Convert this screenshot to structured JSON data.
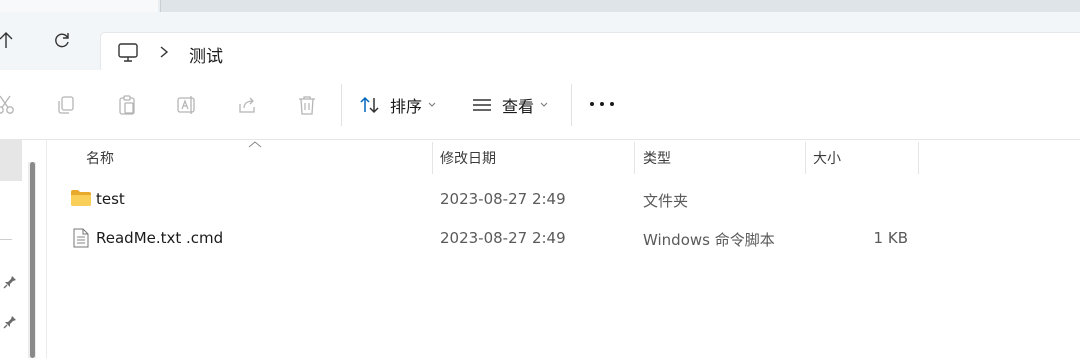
{
  "navbar": {
    "breadcrumb": "测试",
    "icons": [
      "up-arrow-icon",
      "refresh-icon",
      "this-pc-icon",
      "chevron-right-icon"
    ]
  },
  "commandbar": {
    "icons": [
      "cut-icon",
      "copy-icon",
      "paste-icon",
      "rename-icon",
      "share-icon",
      "delete-icon"
    ],
    "sort_label": "排序",
    "view_label": "查看",
    "more_icon": "more-horizontal-icon"
  },
  "columns": {
    "name": "名称",
    "modified": "修改日期",
    "type": "类型",
    "size": "大小"
  },
  "files": [
    {
      "name": "test",
      "modified": "2023-08-27 2:49",
      "type": "文件夹",
      "size": "",
      "icon": "folder-icon"
    },
    {
      "name": "ReadMe.txt .cmd",
      "modified": "2023-08-27 2:49",
      "type": "Windows 命令脚本",
      "size": "1 KB",
      "icon": "text-file-icon"
    }
  ],
  "colors": {
    "accent": "#0067c0",
    "folder": "#f4c344",
    "nav_bg": "#f3f6f9"
  }
}
